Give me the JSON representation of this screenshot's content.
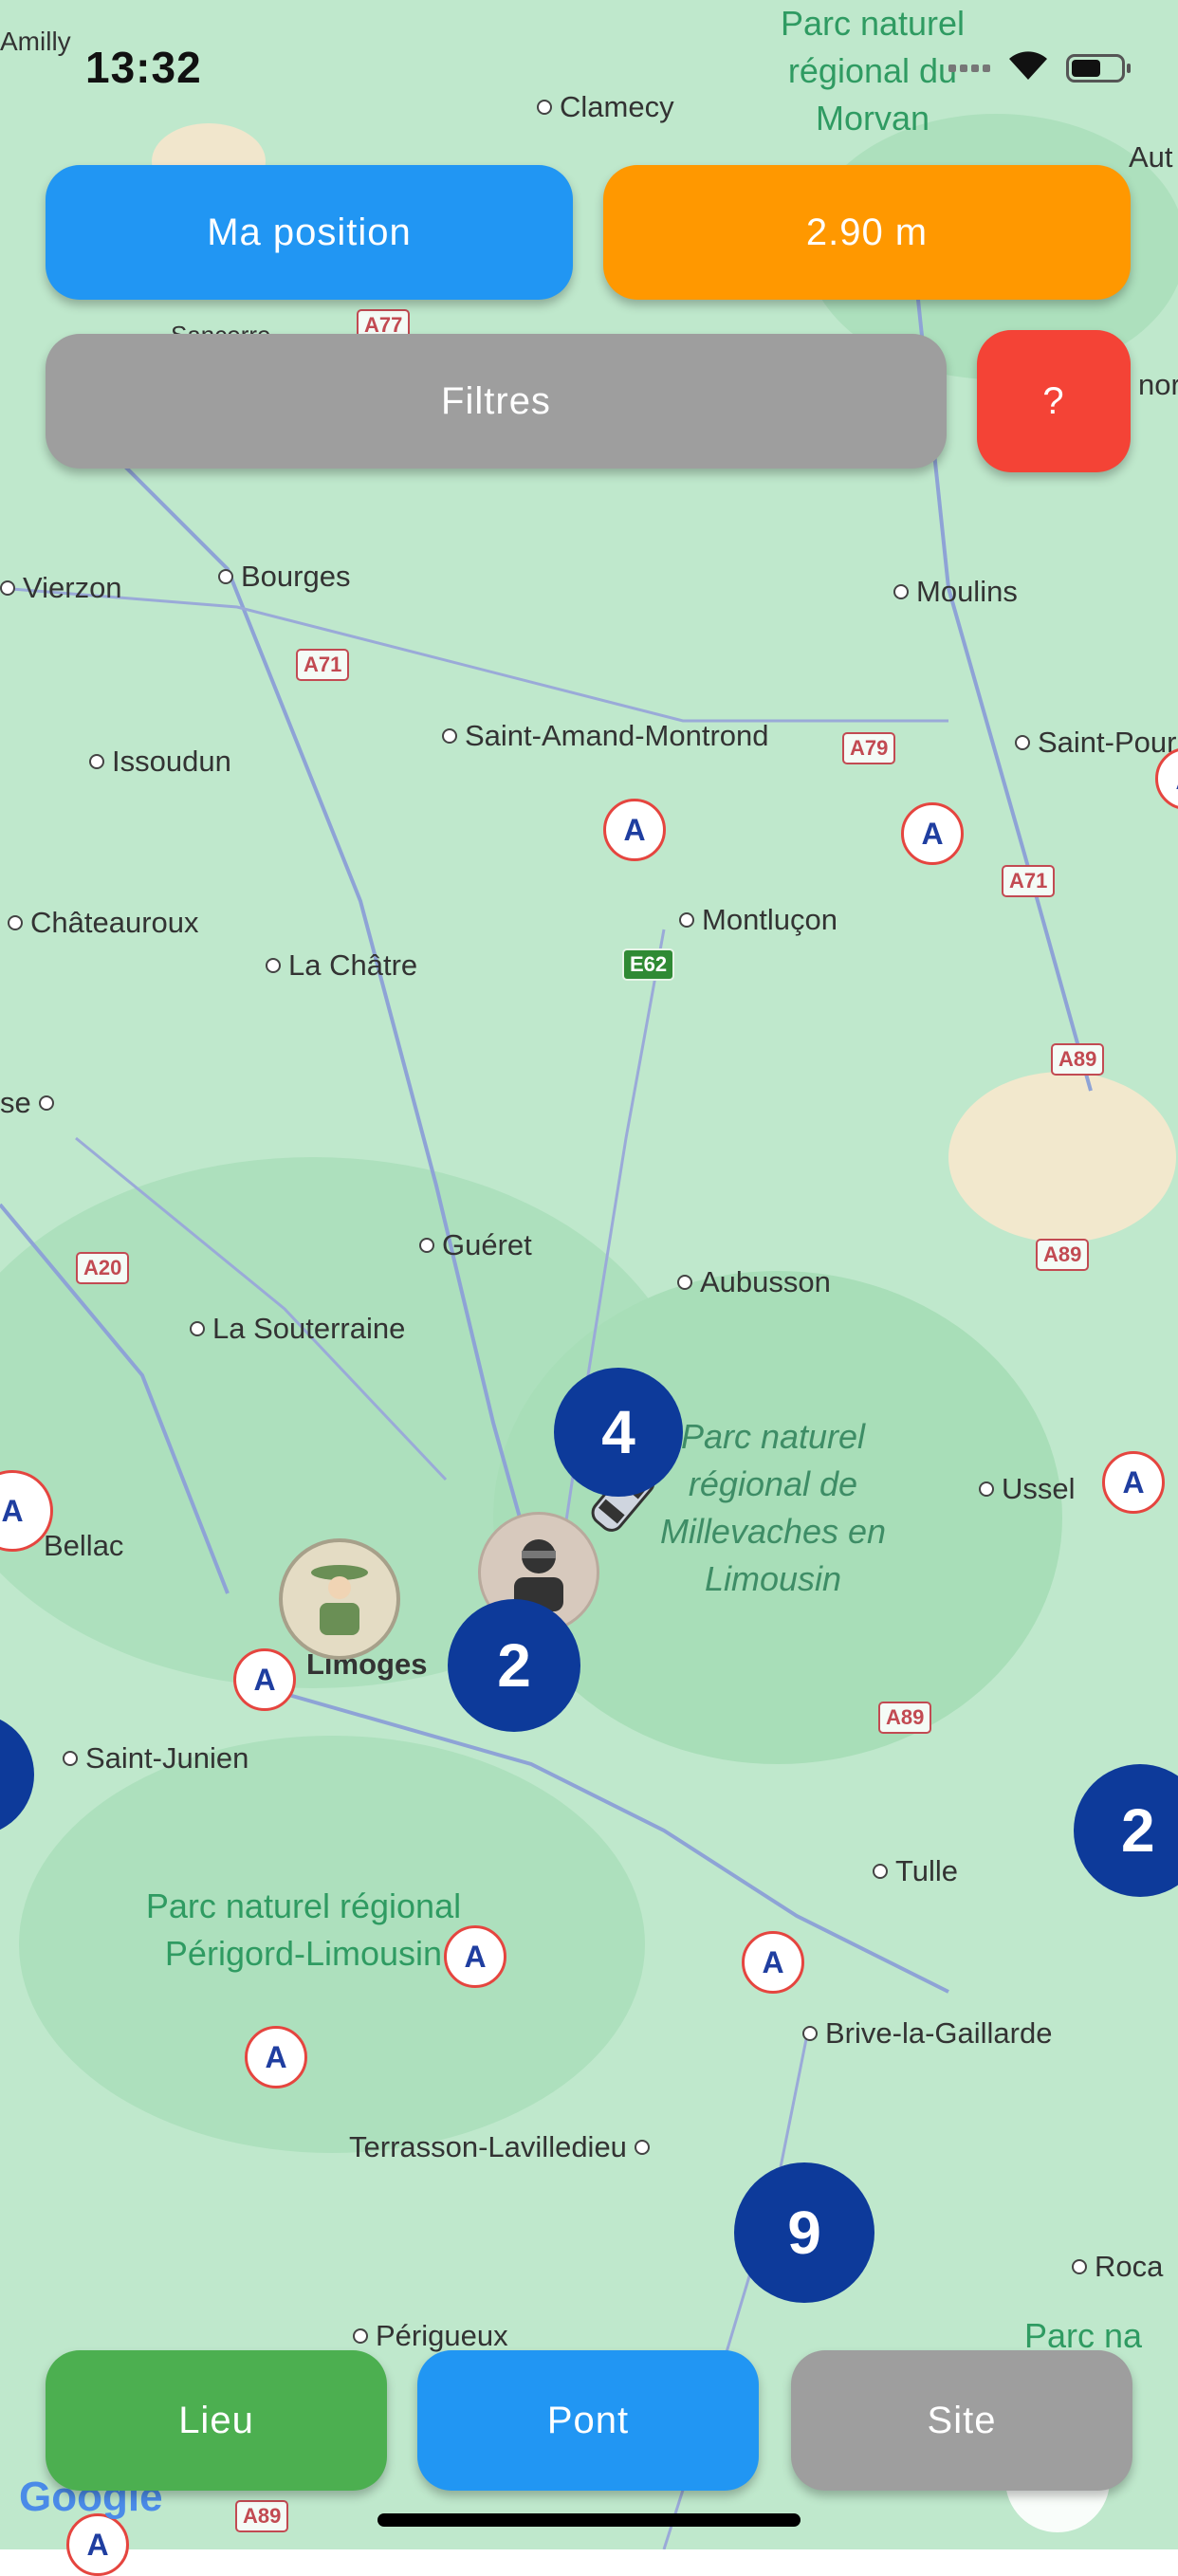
{
  "status": {
    "time": "13:32"
  },
  "buttons": {
    "my_position": "Ma position",
    "height": "2.90 m",
    "filters": "Filtres",
    "help": "?",
    "lieu": "Lieu",
    "pont": "Pont",
    "site": "Site"
  },
  "colors": {
    "blue": "#2196f3",
    "orange": "#ff9800",
    "grey": "#9e9e9e",
    "red": "#f44336",
    "green": "#4caf50",
    "cluster": "#0d3a9a"
  },
  "clusters": [
    "4",
    "2",
    "2",
    "9"
  ],
  "map": {
    "cities": [
      "Amilly",
      "Clamecy",
      "Vierzon",
      "Bourges",
      "Moulins",
      "Issoudun",
      "Saint-Amand-Montrond",
      "Saint-Pour",
      "Châteauroux",
      "La Châtre",
      "Montluçon",
      "Guéret",
      "Aubusson",
      "La Souterraine",
      "Bellac",
      "Limoges",
      "Ussel",
      "Saint-Junien",
      "Tulle",
      "Brive-la-Gaillarde",
      "Terrasson-Lavilledieu",
      "Périgueux",
      "Roca",
      "Sancerre",
      "Aut",
      "nor",
      "se"
    ],
    "roads": [
      "A77",
      "A71",
      "A79",
      "A71",
      "E62",
      "A89",
      "A20",
      "A89",
      "A89",
      "A89"
    ],
    "parks": [
      "Parc naturel régional du Morvan",
      "Parc naturel régional de Millevaches en Limousin",
      "Parc naturel régional Périgord-Limousin",
      "Parc na"
    ],
    "attribution": "Google"
  }
}
